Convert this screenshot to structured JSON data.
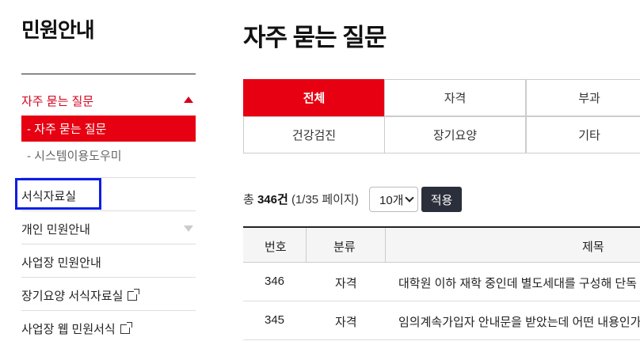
{
  "sidebar": {
    "title": "민원안내",
    "menu": [
      {
        "label": "자주 묻는 질문",
        "state": "expanded"
      },
      {
        "label": "서식자료실"
      },
      {
        "label": "개인 민원안내",
        "state": "collapsed"
      },
      {
        "label": "사업장 민원안내"
      },
      {
        "label": "장기요양 서식자료실",
        "icon": "external-link-icon"
      },
      {
        "label": "사업장 웹 민원서식",
        "icon": "external-link-icon"
      }
    ],
    "submenu": [
      {
        "label": "- 자주 묻는 질문",
        "active": true
      },
      {
        "label": "- 시스템이용도우미",
        "active": false
      }
    ]
  },
  "main": {
    "title": "자주 묻는 질문",
    "tabs": [
      "전체",
      "자격",
      "부과",
      "건강검진",
      "장기요양",
      "기타"
    ],
    "active_tab": "전체",
    "summary": {
      "prefix": "총 ",
      "total": "346건",
      "page_info": " (1/35 페이지)"
    },
    "page_size": "10개",
    "apply_label": "적용",
    "table": {
      "headers": [
        "번호",
        "분류",
        "제목"
      ],
      "rows": [
        [
          "346",
          "자격",
          "대학원 이하 재학 중인데 별도세대를 구성해 단독 세대…"
        ],
        [
          "345",
          "자격",
          "임의계속가입자 안내문을 받았는데 어떤 내용인가요?"
        ]
      ]
    }
  },
  "colors": {
    "accent": "#e60012",
    "highlight_box": "#0a1ee6",
    "button_dark": "#2b2f3c"
  }
}
